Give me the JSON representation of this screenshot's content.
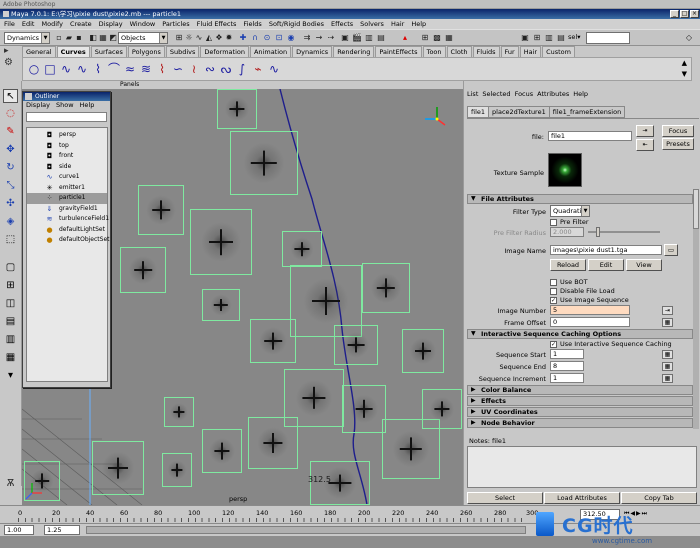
{
  "window": {
    "faint_title": "Adobe Photoshop",
    "title": "Maya 7.0.1: E:\\学习\\pixie dust\\pixie2.mb  ---  particle1",
    "controls": [
      "_",
      "□",
      "×"
    ]
  },
  "menubar": [
    "File",
    "Edit",
    "Modify",
    "Create",
    "Display",
    "Window",
    "Particles",
    "Fluid Effects",
    "Fields",
    "Soft/Rigid Bodies",
    "Effects",
    "Solvers",
    "Hair",
    "Help"
  ],
  "statusline": {
    "menuset": "Dynamics",
    "selection_mode": "Objects",
    "sel_label": "sel▾"
  },
  "shelf_tabs": [
    "General",
    "Curves",
    "Surfaces",
    "Polygons",
    "Subdivs",
    "Deformation",
    "Animation",
    "Dynamics",
    "Rendering",
    "PaintEffects",
    "Toon",
    "Cloth",
    "Fluids",
    "Fur",
    "Hair",
    "Custom"
  ],
  "shelf_active_tab": "Curves",
  "viewport": {
    "panels_menu": "Panels",
    "camera_label": "persp",
    "frame_label": "312.5",
    "particle_line_color": "#1e1e8c",
    "sprite_border_color": "#7fe9a0"
  },
  "outliner": {
    "title": "Outliner",
    "menus": [
      "Display",
      "Show",
      "Help"
    ],
    "items": [
      {
        "label": "persp",
        "icon": "camera-icon"
      },
      {
        "label": "top",
        "icon": "camera-icon"
      },
      {
        "label": "front",
        "icon": "camera-icon"
      },
      {
        "label": "side",
        "icon": "camera-icon"
      },
      {
        "label": "curve1",
        "icon": "curve-icon"
      },
      {
        "label": "emitter1",
        "icon": "emitter-icon"
      },
      {
        "label": "particle1",
        "icon": "particle-icon"
      },
      {
        "label": "gravityField1",
        "icon": "field-icon"
      },
      {
        "label": "turbulenceField1",
        "icon": "field-icon"
      },
      {
        "label": "defaultLightSet",
        "icon": "set-icon"
      },
      {
        "label": "defaultObjectSet",
        "icon": "set-icon"
      }
    ],
    "selected_index": 6
  },
  "attr_editor": {
    "menus": [
      "List",
      "Selected",
      "Focus",
      "Attributes",
      "Help"
    ],
    "tabs": [
      "file1",
      "place2dTexture1",
      "file1_frameExtension"
    ],
    "node_label": "file:",
    "node_value": "file1",
    "focus_label": "Focus",
    "presets_label": "Presets",
    "texture_sample_label": "Texture Sample",
    "file_attributes": {
      "header": "File Attributes",
      "filter_type_label": "Filter Type",
      "filter_type_value": "Quadratic",
      "pre_filter_label": "Pre Filter",
      "pre_filter_radius_label": "Pre Filter Radius",
      "pre_filter_radius_value": "2.000",
      "image_name_label": "Image Name",
      "image_name_value": "images\\pixie dust1.tga",
      "reload": "Reload",
      "edit": "Edit",
      "view": "View",
      "use_bot": "Use BOT",
      "disable_file_load": "Disable File Load",
      "use_image_sequence": "Use Image Sequence",
      "image_number_label": "Image Number",
      "image_number_value": "5",
      "frame_offset_label": "Frame Offset",
      "frame_offset_value": "0"
    },
    "caching": {
      "header": "Interactive Sequence Caching Options",
      "use_caching": "Use Interactive Sequence Caching",
      "start_label": "Sequence Start",
      "start_value": "1",
      "end_label": "Sequence End",
      "end_value": "8",
      "inc_label": "Sequence Increment",
      "inc_value": "1"
    },
    "collapsed_sections": [
      "Color Balance",
      "Effects",
      "UV Coordinates",
      "Node Behavior"
    ],
    "notes_label": "Notes:  file1",
    "bottom_buttons": [
      "Select",
      "Load Attributes",
      "Copy Tab"
    ]
  },
  "timeline": {
    "ticks": [
      "0",
      "20",
      "40",
      "60",
      "80",
      "100",
      "120",
      "140",
      "160",
      "180",
      "200",
      "220",
      "240",
      "260",
      "280",
      "300"
    ],
    "current_frame": "312.50"
  },
  "range": {
    "start": "1.00",
    "current": "1.25"
  },
  "watermark": {
    "brand": "CG时代",
    "url": "www.cgtime.com"
  }
}
